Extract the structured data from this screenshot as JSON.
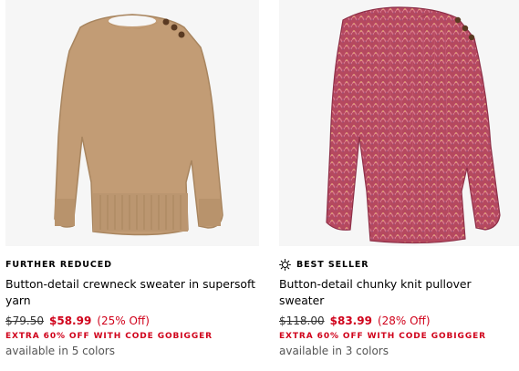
{
  "products": [
    {
      "badge": "FURTHER REDUCED",
      "title": "Button-detail crewneck sweater in supersoft yarn",
      "was_price": "$79.50",
      "sale_price": "$58.99",
      "discount": "(25% Off)",
      "promo": "EXTRA 60% OFF WITH CODE GOBIGGER",
      "colors": "available in 5 colors",
      "image_icon": "camel-sweater-image",
      "color": "#c4a07a"
    },
    {
      "badge": "BEST SELLER",
      "badge_icon": "sun-star-icon",
      "title": "Button-detail chunky knit pullover sweater",
      "was_price": "$118.00",
      "sale_price": "$83.99",
      "discount": "(28% Off)",
      "promo": "EXTRA 60% OFF WITH CODE GOBIGGER",
      "colors": "available in 3 colors",
      "image_icon": "pink-chunky-sweater-image",
      "color": "#b84a62"
    }
  ],
  "colors": {
    "sale_red": "#d0021b",
    "text": "#000000",
    "muted": "#555555"
  }
}
